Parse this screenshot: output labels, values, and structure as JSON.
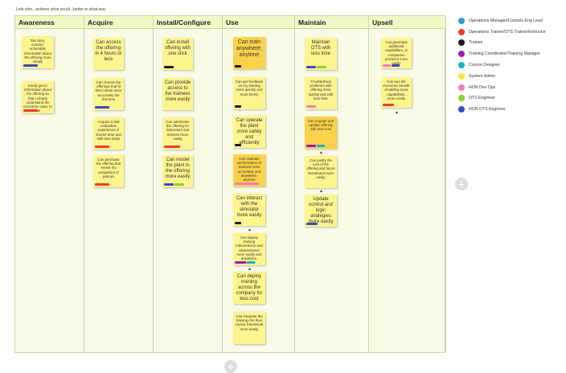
{
  "subtitle": "Lets who...achieve what result...better in what way",
  "columns": [
    {
      "title": "Awareness"
    },
    {
      "title": "Acquire"
    },
    {
      "title": "Install/Configure"
    },
    {
      "title": "Use"
    },
    {
      "title": "Maintain"
    },
    {
      "title": "Upsell"
    }
  ],
  "notes": {
    "awareness": [
      "Get clear, concise, actionable information about the offering more simply",
      "Easily get to information about the offering so that I clearly understand the economic value to me"
    ],
    "acquire": [
      "Can access the offering in 4 hours or less",
      "Can choose the offerings that fit their needs more accurately the first time",
      "Acquire a trial evaluation experience in shorter time and with less steps",
      "Can purchase the offering that meets my companies IT policies"
    ],
    "install": [
      "Can install offering with one click",
      "Can provide access to the trainees more easily",
      "Can administer the offering for instructors and trainees more easily",
      "Can model the plant in the offering more easily"
    ],
    "use": [
      "Can train anywhere, anytime",
      "Can get feedback on my training more quickly and more timely",
      "Can operate the plant more safely and efficiently",
      "Can evaluate performance of trainees more accurately and anywhere, anytime",
      "Can interact with the simulator more easily",
      "Can deploy training interventions and assessments more easily and anywhere, anytime",
      "Can deploy training across the company for less cost",
      "Can integrate the training into their course framework more easily"
    ],
    "maintain": [
      "Maintain OTS with less time",
      "Troubleshoot problems with offering more quickly and with less time",
      "Can migrate and update offering with less cost",
      "Can justify the cost of the offering and future investment more easily",
      "Update control and logic strategies more easily"
    ],
    "upsell": [
      "Can purchase additional capabilities, or companion products more easily",
      "Can see the economic benefit of adding more capabilities, more easily"
    ]
  },
  "legend": [
    {
      "label": "Operations Manager/Controls Eng Lead",
      "color": "#2d9cdb"
    },
    {
      "label": "Operations Trainer/OTS Trainer/Instructor",
      "color": "#eb3b2f"
    },
    {
      "label": "Trainee",
      "color": "#1a1a1a"
    },
    {
      "label": "Training Coordinator/Training Manager",
      "color": "#9b1bb5"
    },
    {
      "label": "Course Designer",
      "color": "#17b3c7"
    },
    {
      "label": "System Admin",
      "color": "#f2e93a"
    },
    {
      "label": "HON Dev Ops",
      "color": "#f27bb8"
    },
    {
      "label": "OTS Engineer",
      "color": "#8bd12f"
    },
    {
      "label": "HON OTS Engineer",
      "color": "#3b4bb8"
    }
  ],
  "icons": {
    "add": "+",
    "add_name": "plus-icon",
    "arrow": "▲"
  }
}
